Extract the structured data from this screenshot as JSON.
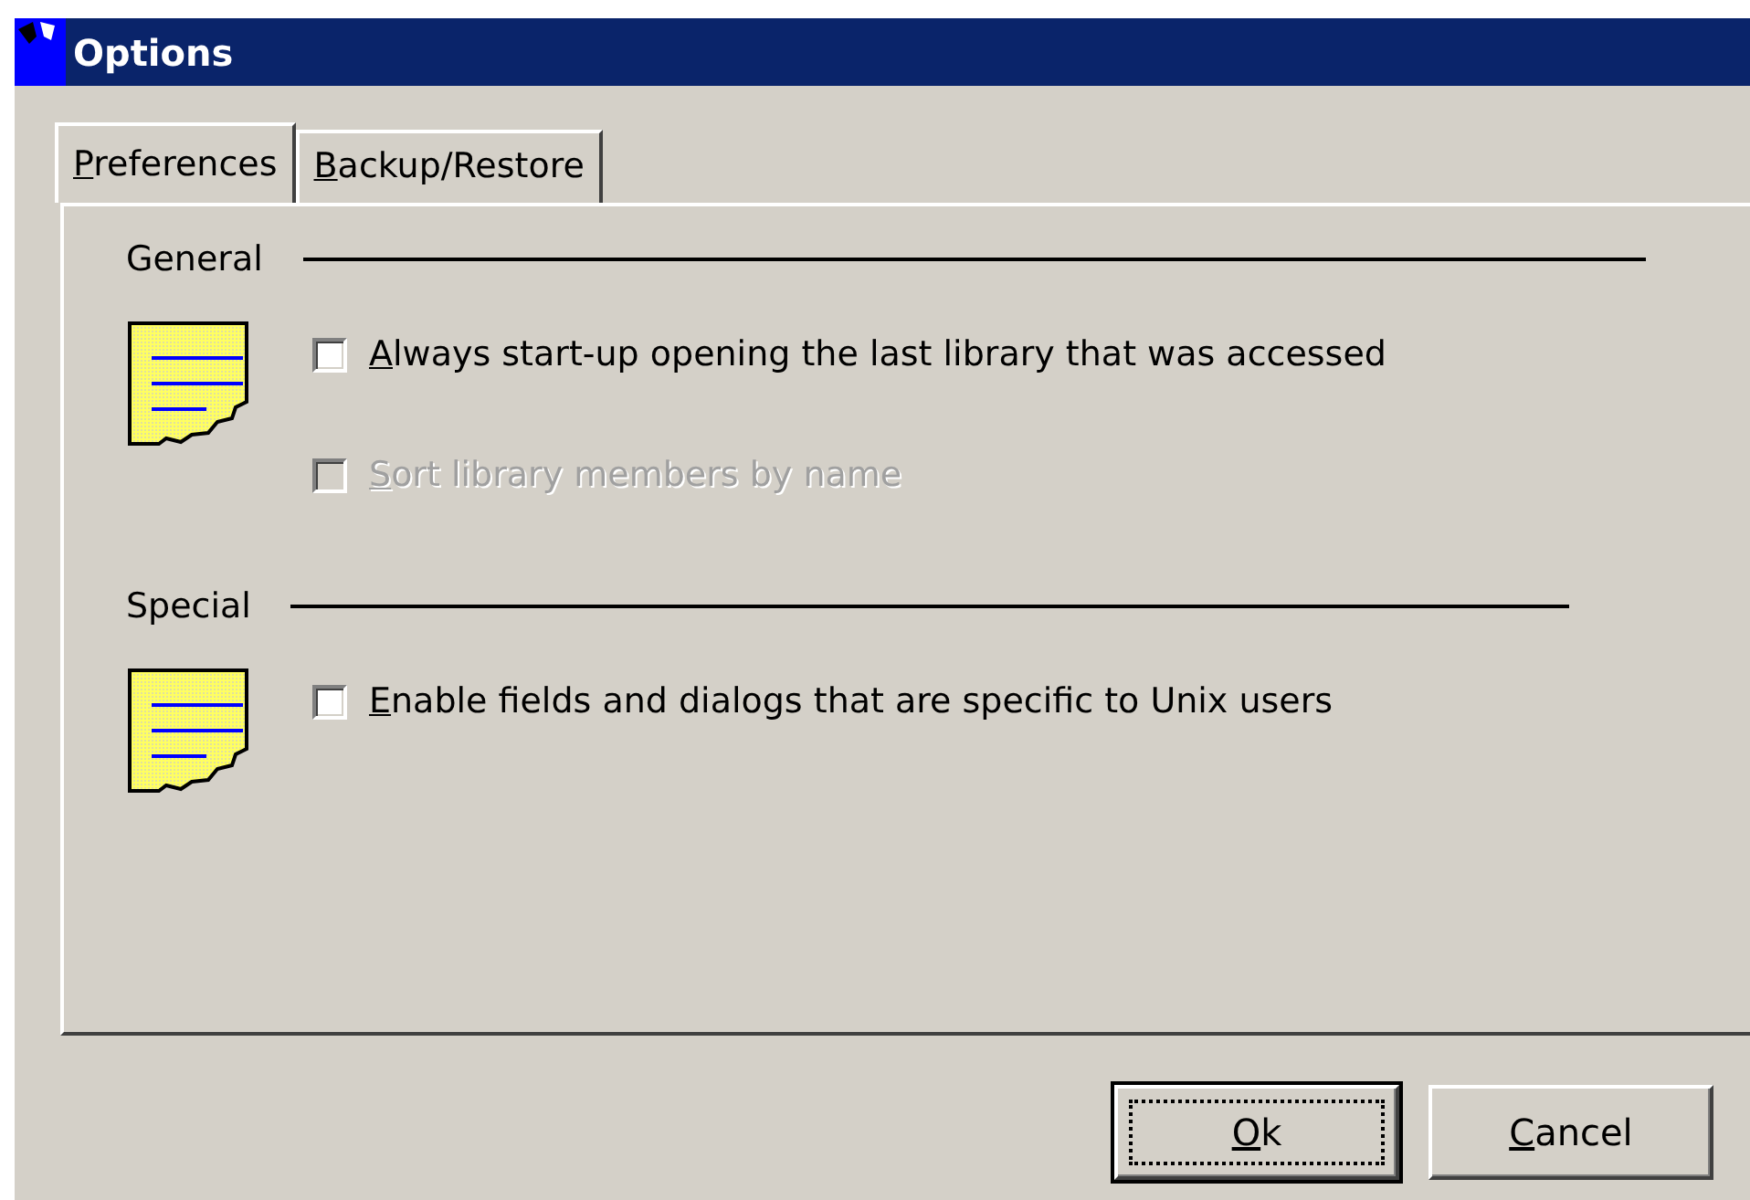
{
  "window": {
    "title": "Options"
  },
  "tabs": [
    {
      "key": "P",
      "rest": "references",
      "selected": true
    },
    {
      "key": "B",
      "rest": "ackup/Restore",
      "selected": false
    }
  ],
  "sections": [
    {
      "title": "General",
      "options": [
        {
          "key": "A",
          "rest": "lways start-up opening the last library that was accessed",
          "checked": false,
          "disabled": false
        },
        {
          "key": "S",
          "rest": "ort library members by name",
          "checked": false,
          "disabled": true
        }
      ]
    },
    {
      "title": "Special",
      "options": [
        {
          "key": "E",
          "rest": "nable fields and dialogs that are specific to Unix users",
          "checked": false,
          "disabled": false
        }
      ]
    }
  ],
  "buttons": [
    {
      "key": "O",
      "rest": "k",
      "default": true
    },
    {
      "key": "C",
      "rest": "ancel",
      "default": false
    }
  ]
}
